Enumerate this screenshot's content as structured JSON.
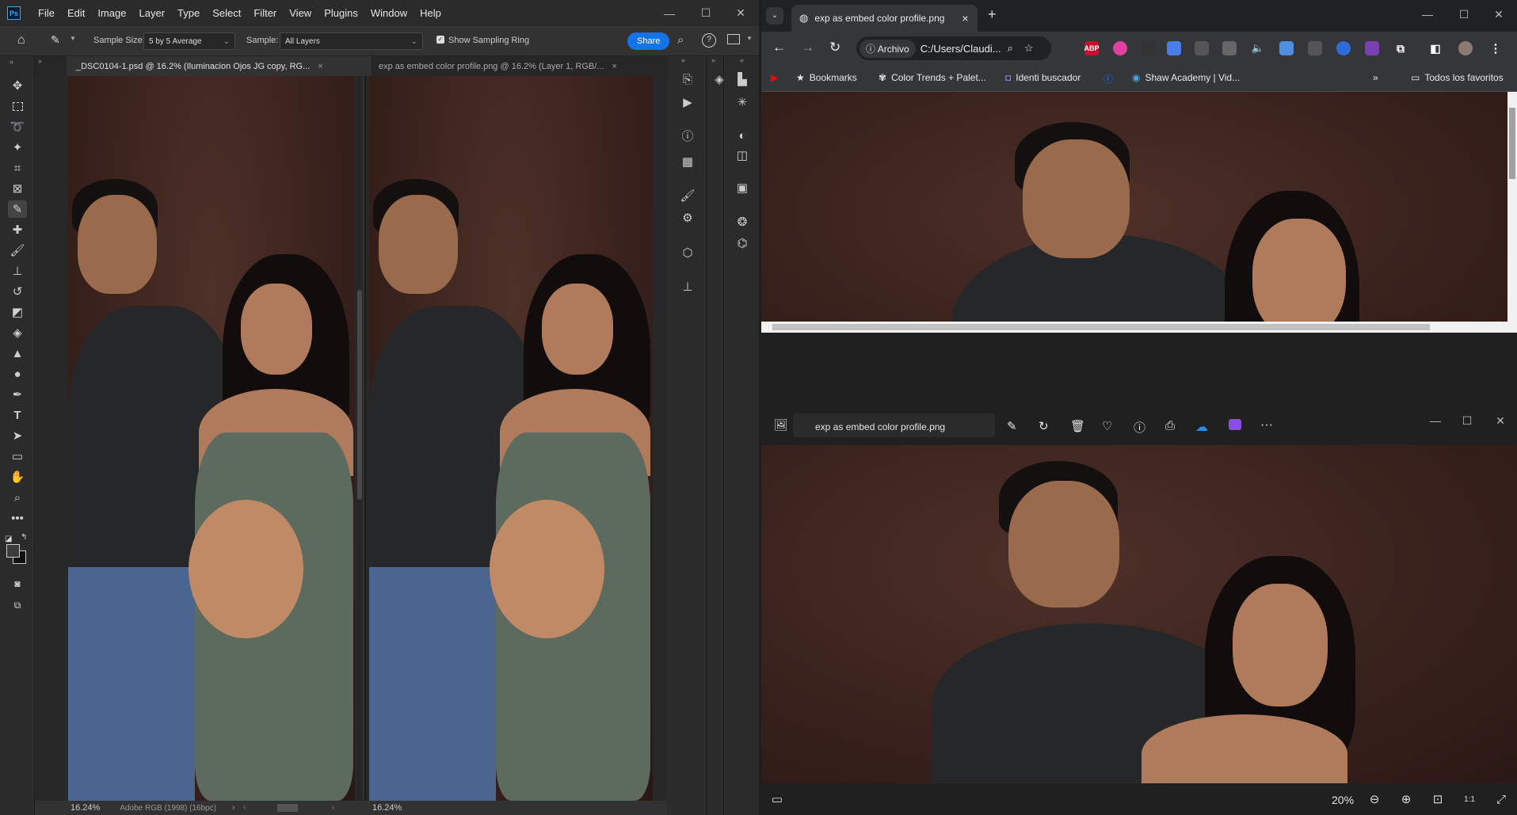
{
  "photoshop": {
    "logo": "Ps",
    "menu": [
      "File",
      "Edit",
      "Image",
      "Layer",
      "Type",
      "Select",
      "Filter",
      "View",
      "Plugins",
      "Window",
      "Help"
    ],
    "options": {
      "sample_size_label": "Sample Size:",
      "sample_size_value": "5 by 5 Average",
      "sample_label": "Sample:",
      "sample_value": "All Layers",
      "show_ring_label": "Show Sampling Ring",
      "share_label": "Share"
    },
    "tabs": [
      {
        "title": "_DSC0104-1.psd @ 16.2% (Iluminacion Ojos JG copy, RG...",
        "close": "×"
      },
      {
        "title": "exp as embed color profile.png @ 16.2% (Layer 1, RGB/...",
        "close": "×"
      }
    ],
    "status_left": {
      "zoom": "16.24%",
      "profile": "Adobe RGB (1998) (16bpc)"
    },
    "status_right": {
      "zoom": "16.24%"
    }
  },
  "chrome": {
    "tab_title": "exp as embed color profile.png",
    "tab_close": "×",
    "new_tab": "+",
    "omnibox_chip": "Archivo",
    "omnibox_text": "C:/Users/Claudi...",
    "bookmarks": [
      {
        "label": "Bookmarks",
        "icon": "star-icon"
      },
      {
        "label": "Color Trends + Palet...",
        "icon": "palette-icon"
      },
      {
        "label": "Identi buscador",
        "icon": "id-icon"
      },
      {
        "label": "Shaw Academy | Vid...",
        "icon": "shaw-icon"
      }
    ],
    "all_bookmarks_label": "Todos los favoritos",
    "ext_abp": "ABP"
  },
  "photos_app": {
    "title": "exp as embed color profile.png",
    "zoom_label": "20%"
  }
}
